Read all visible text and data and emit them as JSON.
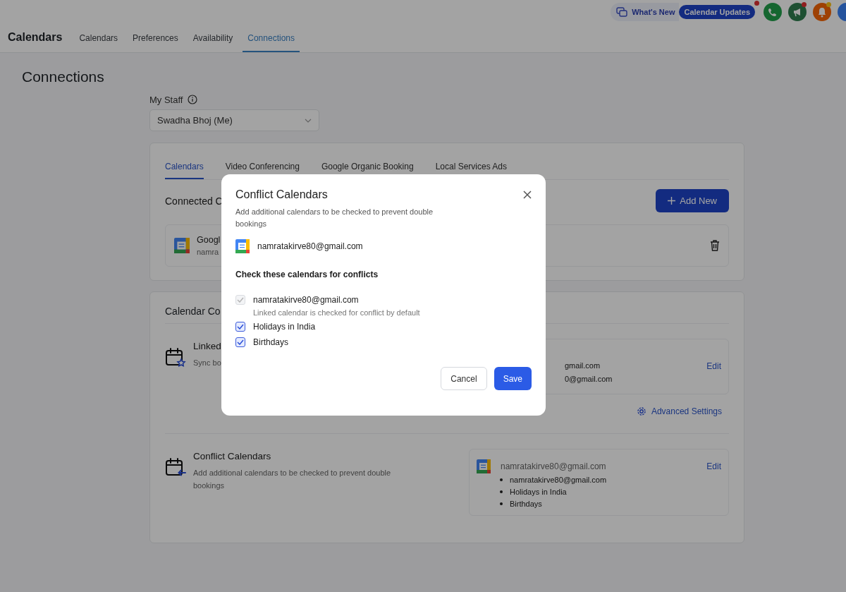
{
  "header": {
    "app_title": "Calendars",
    "nav": [
      {
        "label": "Calendars",
        "selected": false
      },
      {
        "label": "Preferences",
        "selected": false
      },
      {
        "label": "Availability",
        "selected": false
      },
      {
        "label": "Connections",
        "selected": true
      }
    ],
    "whats_new": "What's New",
    "updates_badge": "Calendar Updates"
  },
  "page": {
    "title": "Connections",
    "staff": {
      "label": "My Staff",
      "value": "Swadha Bhoj (Me)"
    }
  },
  "connections_card": {
    "tabs": [
      {
        "label": "Calendars",
        "selected": true
      },
      {
        "label": "Video Conferencing",
        "selected": false
      },
      {
        "label": "Google Organic Booking",
        "selected": false
      },
      {
        "label": "Local Services Ads",
        "selected": false
      }
    ],
    "section_title": "Connected C",
    "add_button": "Add New",
    "account": {
      "name": "Googl",
      "email": "namra"
    }
  },
  "settings_card": {
    "title": "Calendar Co",
    "linked": {
      "title": "Linked",
      "description": "Sync bo",
      "accounts": [
        "gmail.com",
        "0@gmail.com"
      ],
      "edit": "Edit"
    },
    "advanced": "Advanced Settings",
    "conflict": {
      "title": "Conflict Calendars",
      "description": "Add additional calendars to be checked to prevent double bookings",
      "account": "namratakirve80@gmail.com",
      "calendars": [
        "namratakirve80@gmail.com",
        "Holidays in India",
        "Birthdays"
      ],
      "edit": "Edit"
    }
  },
  "dialog": {
    "title": "Conflict Calendars",
    "description": "Add additional calendars to be checked to prevent double bookings",
    "account": "namratakirve80@gmail.com",
    "section_title": "Check these calendars for conflicts",
    "calendars": [
      {
        "name": "namratakirve80@gmail.com",
        "note": "Linked calendar is checked for conflict by default",
        "checked": true,
        "disabled": true
      },
      {
        "name": "Holidays in India",
        "checked": true,
        "disabled": false
      },
      {
        "name": "Birthdays",
        "checked": true,
        "disabled": false
      }
    ],
    "cancel": "Cancel",
    "save": "Save"
  }
}
